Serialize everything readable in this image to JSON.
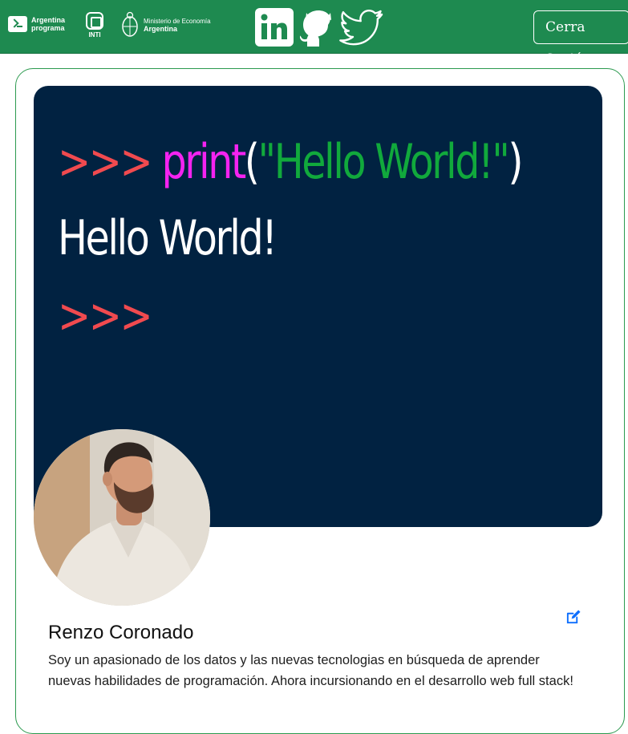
{
  "header": {
    "logos": {
      "argentina_programa": [
        "Argentina",
        "programa"
      ],
      "inti": "INTI",
      "ministerio": [
        "Ministerio de Economía",
        "Argentina"
      ]
    },
    "social_icons": [
      "linkedin-icon",
      "github-icon",
      "twitter-icon"
    ],
    "logout_label": "Cerra Sesión"
  },
  "banner": {
    "line1": {
      "prompt": ">>> ",
      "keyword": "print",
      "open_paren": "(",
      "string": "\"Hello World!\"",
      "close_paren": ")"
    },
    "line2": "Hello World!",
    "line3": {
      "prompt": ">>>"
    }
  },
  "profile": {
    "name": "Renzo Coronado",
    "bio": "Soy un apasionado de los datos y las nuevas tecnologias en búsqueda de aprender nuevas habilidades de programación. Ahora incursionando en el desarrollo web full stack!"
  },
  "colors": {
    "header_bg": "#1e8a50",
    "banner_bg": "#012241",
    "prompt": "#f14a4f",
    "keyword": "#f423f0",
    "string": "#11a93c",
    "edit_icon": "#0d6efd"
  }
}
